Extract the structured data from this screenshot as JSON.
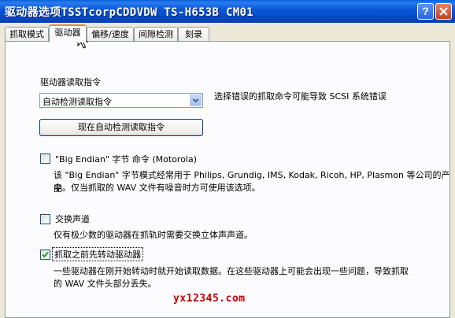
{
  "window": {
    "title": "驱动器选项TSSTcorpCDDVDW TS-H653B CM01",
    "help_label": "?"
  },
  "tabs": [
    {
      "label": "抓取模式",
      "active": false
    },
    {
      "label": "驱动器",
      "active": true
    },
    {
      "label": "偏移/速度",
      "active": false
    },
    {
      "label": "间隙检测",
      "active": false
    },
    {
      "label": "刻录",
      "active": false
    }
  ],
  "read_command": {
    "label": "驱动器读取指令",
    "selected": "自动检测读取指令",
    "hint": "选择错误的抓取命令可能导致 SCSI 系统错误",
    "detect_button": "现在自动检测读取指令"
  },
  "big_endian": {
    "label": "\"Big Endian\" 字节 命令 (Motorola)",
    "checked": false,
    "desc_line1": "该 \"Big Endian\" 字节模式经常用于 Philips, Grundig, IMS, Kodak, Ricoh, HP, Plasmon 等公司的产品",
    "desc_line2": "中。仅当抓取的 WAV 文件有噪音时方可使用该选项。"
  },
  "swap_channels": {
    "label": "交换声道",
    "checked": false,
    "desc": "仅有极少数的驱动器在抓轨时需要交换立体声声道。"
  },
  "spin_up": {
    "label": "抓取之前先转动驱动器",
    "checked": true,
    "desc_line1": "一些驱动器在刚开始转动时就开始读取数据。在这些驱动器上可能会出现一些问题，导致抓取",
    "desc_line2": "的 WAV 文件头部分丢失。"
  },
  "watermark": "yx12345.com"
}
